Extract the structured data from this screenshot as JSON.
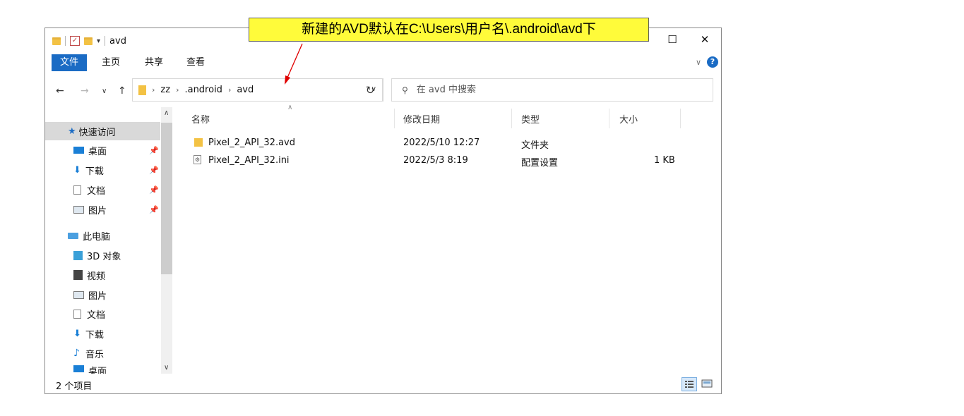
{
  "window": {
    "title": "avd",
    "controls": {
      "maximize": "☐",
      "close": "✕"
    }
  },
  "ribbon": {
    "tabs": [
      "文件",
      "主页",
      "共享",
      "查看"
    ],
    "help": "?"
  },
  "address": {
    "crumbs": [
      "zz",
      ".android",
      "avd"
    ]
  },
  "search": {
    "placeholder": "在 avd 中搜索"
  },
  "sidebar": {
    "quick_access": "快速访问",
    "quick_items": [
      "桌面",
      "下载",
      "文档",
      "图片"
    ],
    "this_pc": "此电脑",
    "pc_items": [
      "3D 对象",
      "视频",
      "图片",
      "文档",
      "下载",
      "音乐",
      "桌面"
    ]
  },
  "columns": {
    "name": "名称",
    "modified": "修改日期",
    "type": "类型",
    "size": "大小"
  },
  "files": [
    {
      "name": "Pixel_2_API_32.avd",
      "modified": "2022/5/10 12:27",
      "type": "文件夹",
      "size": ""
    },
    {
      "name": "Pixel_2_API_32.ini",
      "modified": "2022/5/3 8:19",
      "type": "配置设置",
      "size": "1 KB"
    }
  ],
  "status": {
    "count": "2 个项目"
  },
  "annotation": {
    "text": "新建的AVD默认在C:\\Users\\用户名\\.android\\avd下",
    "color": "#fffb3a",
    "arrow_color": "#e00000"
  },
  "colors": {
    "accent": "#1a6bc4",
    "folder": "#f3c244",
    "selected": "#d9d9d9"
  }
}
